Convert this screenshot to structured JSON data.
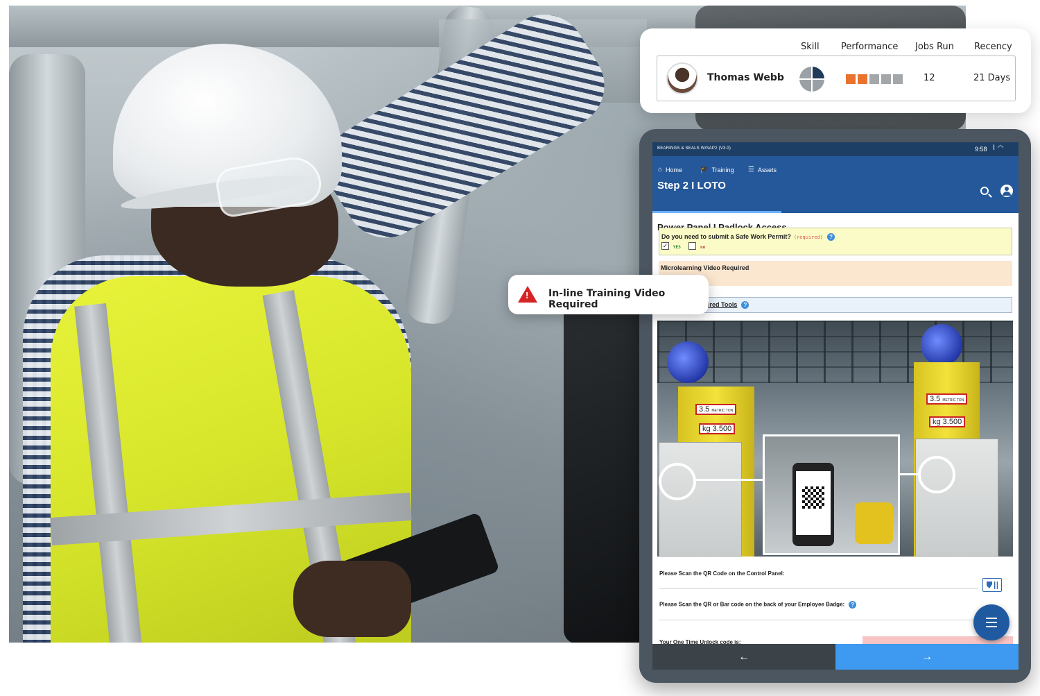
{
  "worker_card": {
    "headers": {
      "skill": "Skill",
      "performance": "Performance",
      "jobs_run": "Jobs Run",
      "recency": "Recency"
    },
    "name": "Thomas Webb",
    "skill_icon": "pie-quarter-icon",
    "performance": {
      "filled": 2,
      "total": 5,
      "filled_color": "#e8732f",
      "empty_color": "#a3a7aa"
    },
    "jobs_run": "12",
    "recency": "21 Days"
  },
  "callout": {
    "icon": "warning-icon",
    "text": "In-line Training Video Required"
  },
  "tablet": {
    "status_bar": {
      "app_name": "BEARINGS & SEALS W/SAP2 (V3.0)",
      "time": "9:58"
    },
    "nav": {
      "home": "Home",
      "training": "Training",
      "assets": "Assets"
    },
    "step_title": "Step 2 I LOTO",
    "form_title": "Power Panel I Padlock Access",
    "question": {
      "text": "Do you need to submit a Safe Work Permit?",
      "required_tag": "(required)",
      "yes_label": "YES",
      "no_label": "no",
      "yes_checked": true,
      "no_checked": false
    },
    "microlearning": "Microlearning Video Required",
    "tools": "ired Tools",
    "photo": {
      "left_capacity": "3.5",
      "left_capacity_unit": "METRIC TON",
      "left_weight": "kg 3.500",
      "right_capacity": "3.5",
      "right_capacity_unit": "METRIC TON",
      "right_weight": "kg 3.500"
    },
    "scan_qr_label": "Please Scan the QR Code on the Control Panel:",
    "scan_badge_label": "Please Scan the QR or Bar code on the back of your Employee Badge:",
    "unlock_label": "Your One Time Unlock code is:",
    "back_arrow": "←",
    "next_arrow": "→"
  },
  "colors": {
    "app_bar": "#24589a",
    "status_bar": "#1d3f66",
    "question_bg": "#fbfbc7",
    "micro_bg": "#fbe6cf",
    "warning": "#d62424",
    "next_button": "#3d9af0"
  }
}
